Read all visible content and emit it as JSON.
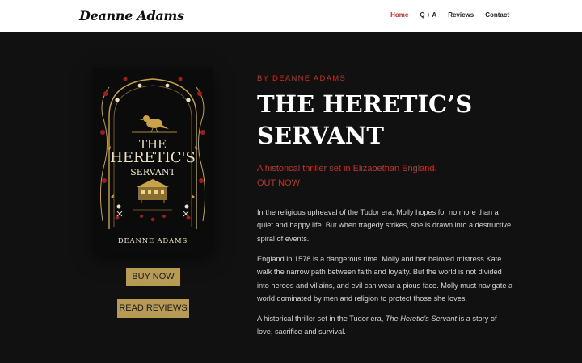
{
  "header": {
    "logo": "Deanne Adams",
    "nav": [
      {
        "label": "Home",
        "active": true
      },
      {
        "label": "Q + A"
      },
      {
        "label": "Reviews"
      },
      {
        "label": "Contact"
      }
    ]
  },
  "cover": {
    "title_line1": "THE",
    "title_line2": "HERETIC'S",
    "title_line3": "SERVANT",
    "author": "DEANNE ADAMS"
  },
  "buttons": {
    "buy": "BUY NOW",
    "reviews": "READ REVIEWS"
  },
  "book": {
    "byline": "BY DEANNE ADAMS",
    "title_line1": "THE HERETIC’S",
    "title_line2": "SERVANT",
    "tagline": "A historical thriller set in Elizabethan England.",
    "status": "OUT NOW",
    "para1": "In the religious upheaval of the Tudor era, Molly hopes for no more than a quiet and happy life. But when tragedy strikes, she is drawn into a destructive spiral of events.",
    "para2": "England in 1578 is a dangerous time. Molly and her beloved mistress Kate walk the narrow path between faith and loyalty. But the world is not divided into heroes and villains, and evil can wear a pious face. Molly must navigate a world dominated by men and religion to protect those she loves.",
    "para3_before": "A historical thriller set in the Tudor era, ",
    "para3_italic": "The Heretic’s Servant",
    "para3_after": " is a story of love, sacrifice and survival."
  },
  "colors": {
    "accent": "#c4332a",
    "button": "#b79a54",
    "background": "#111111",
    "cover_gold": "#c9a24a"
  }
}
